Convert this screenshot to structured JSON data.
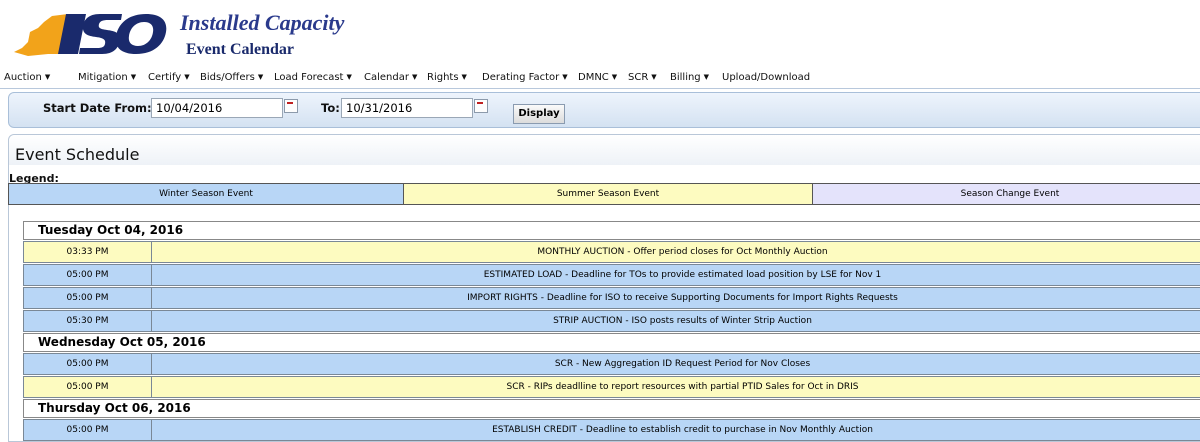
{
  "header": {
    "logo_text": "ISO",
    "title": "Installed Capacity",
    "subtitle": "Event Calendar",
    "colors": {
      "brand_orange": "#f2a31a",
      "brand_navy": "#1a2a6c"
    }
  },
  "menu": [
    {
      "label": "Auction"
    },
    {
      "label": "Mitigation"
    },
    {
      "label": "Certify"
    },
    {
      "label": "Bids/Offers"
    },
    {
      "label": "Load Forecast"
    },
    {
      "label": "Calendar"
    },
    {
      "label": "Rights"
    },
    {
      "label": "Derating Factor"
    },
    {
      "label": "DMNC"
    },
    {
      "label": "SCR"
    },
    {
      "label": "Billing"
    },
    {
      "label": "Upload/Download"
    }
  ],
  "filter": {
    "start_label": "Start Date From:",
    "start_value": "10/04/2016",
    "to_label": "To:",
    "to_value": "10/31/2016",
    "display_button": "Display"
  },
  "schedule": {
    "title": "Event Schedule",
    "legend_label": "Legend:",
    "legend": [
      {
        "label": "Winter Season Event",
        "color": "#b8d6f6"
      },
      {
        "label": "Summer Season Event",
        "color": "#fdfbc0"
      },
      {
        "label": "Season Change Event",
        "color": "#e4e3fb"
      }
    ],
    "days": [
      {
        "date": "Tuesday Oct 04, 2016",
        "events": [
          {
            "time": "03:33 PM",
            "text": "MONTHLY AUCTION - Offer period closes for Oct Monthly Auction",
            "season": "summer"
          },
          {
            "time": "05:00 PM",
            "text": "ESTIMATED LOAD - Deadline for TOs to provide estimated load position by LSE for Nov 1",
            "season": "winter"
          },
          {
            "time": "05:00 PM",
            "text": "IMPORT RIGHTS - Deadline for ISO to receive Supporting Documents for Import Rights Requests",
            "season": "winter"
          },
          {
            "time": "05:30 PM",
            "text": "STRIP AUCTION - ISO posts results of Winter Strip Auction",
            "season": "winter"
          }
        ]
      },
      {
        "date": "Wednesday Oct 05, 2016",
        "events": [
          {
            "time": "05:00 PM",
            "text": "SCR - New Aggregation ID Request Period for Nov Closes",
            "season": "winter"
          },
          {
            "time": "05:00 PM",
            "text": "SCR - RIPs deadlline to report resources with partial PTID Sales for Oct in DRIS",
            "season": "summer"
          }
        ]
      },
      {
        "date": "Thursday Oct 06, 2016",
        "events": [
          {
            "time": "05:00 PM",
            "text": "ESTABLISH CREDIT - Deadline to establish credit to purchase in Nov Monthly Auction",
            "season": "winter"
          }
        ]
      }
    ]
  }
}
